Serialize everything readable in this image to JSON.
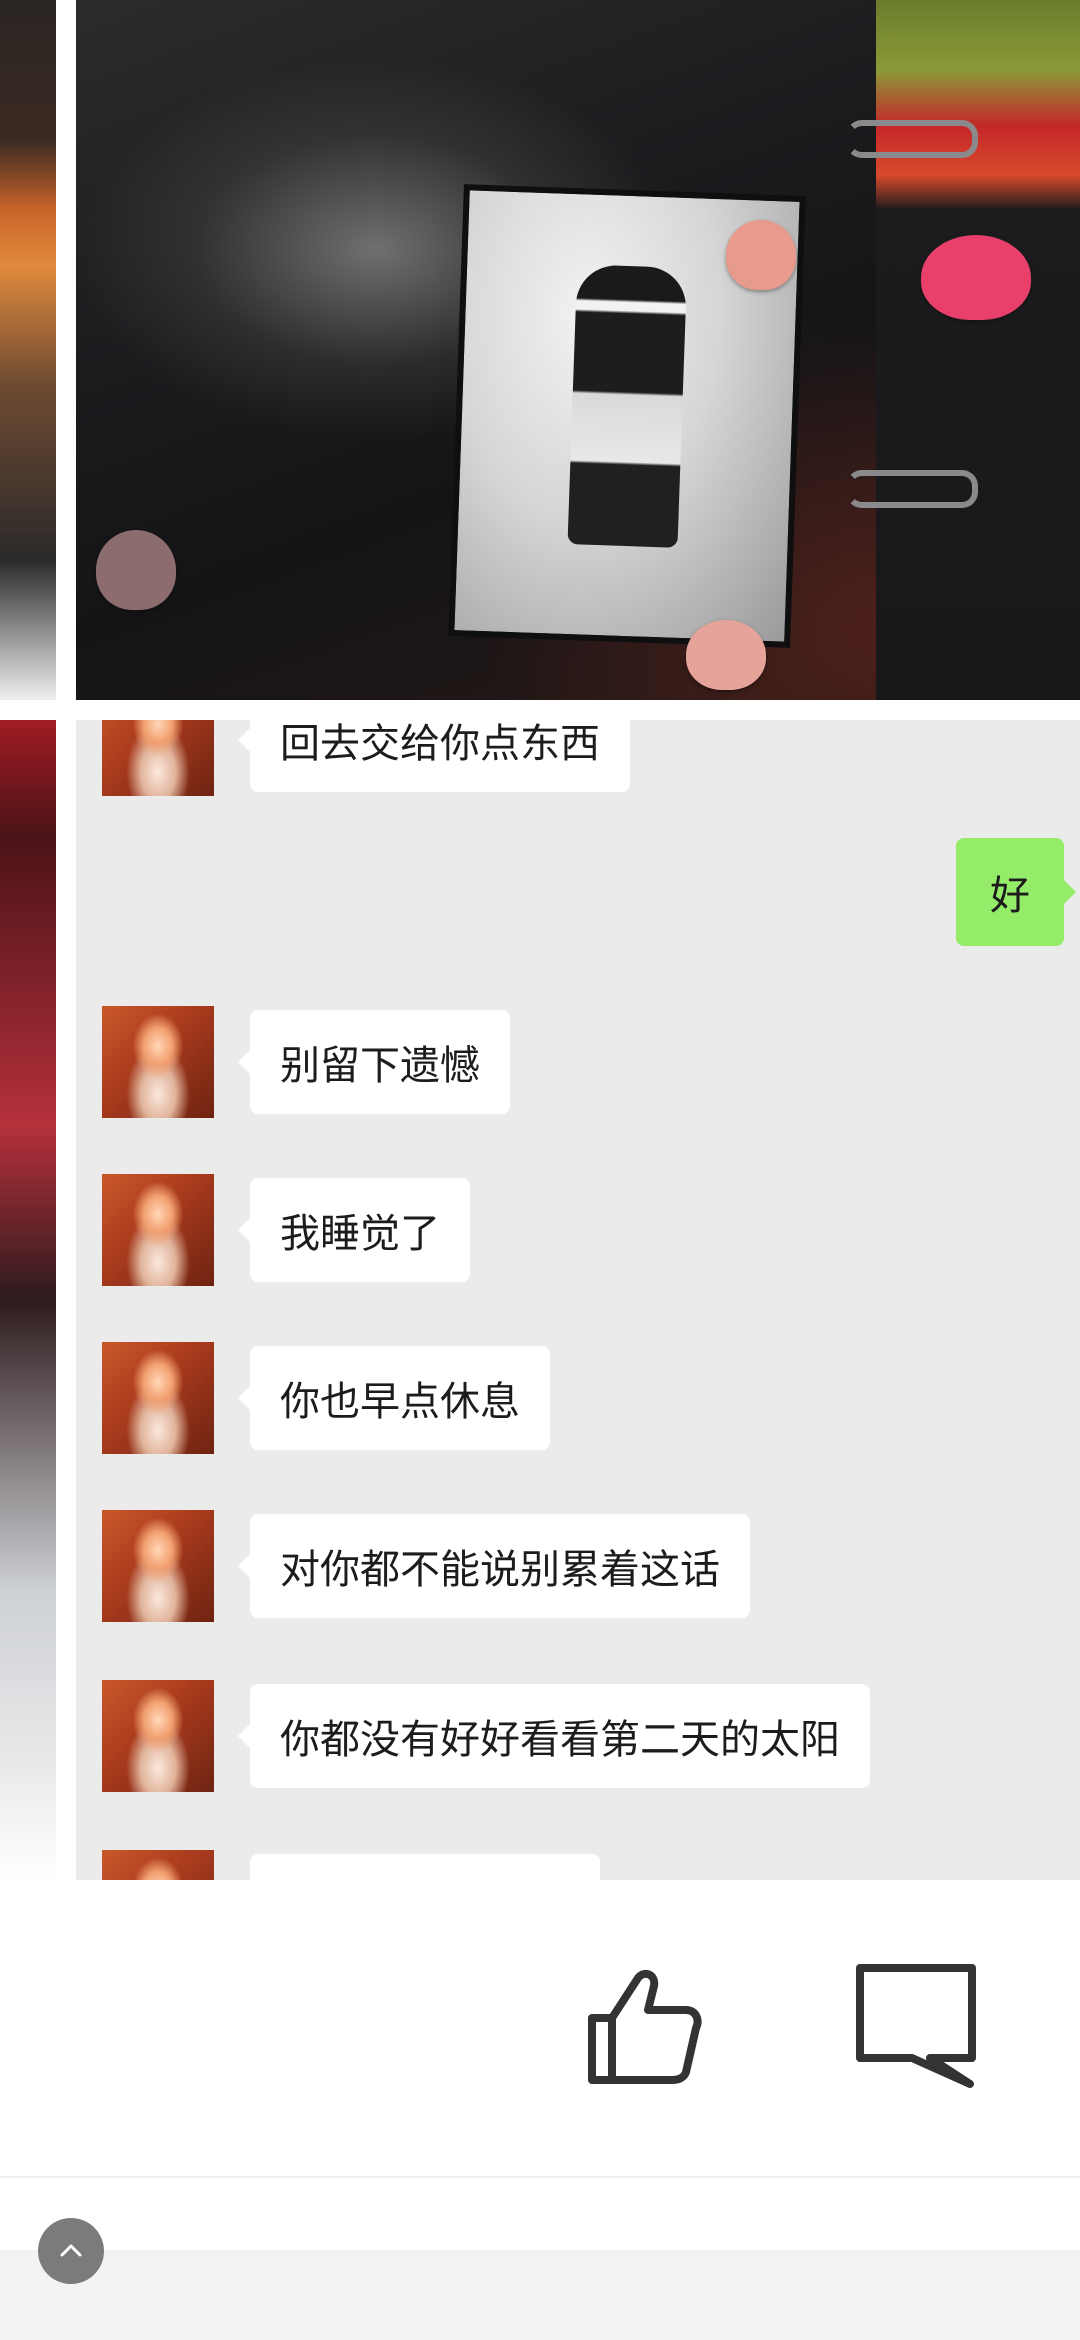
{
  "chat": {
    "messages": [
      {
        "sender": "other",
        "text": "回去交给你点东西"
      },
      {
        "sender": "self",
        "text": "好"
      },
      {
        "sender": "other",
        "text": "别留下遗憾"
      },
      {
        "sender": "other",
        "text": "我睡觉了"
      },
      {
        "sender": "other",
        "text": "你也早点休息"
      },
      {
        "sender": "other",
        "text": "对你都不能说别累着这话"
      },
      {
        "sender": "other",
        "text": "你都没有好好看看第二天的太阳"
      },
      {
        "sender": "other",
        "text": ""
      }
    ],
    "colors": {
      "background": "#ebebeb",
      "other_bubble": "#ffffff",
      "self_bubble": "#95ec69"
    }
  },
  "actions": {
    "like_icon": "thumbs-up-icon",
    "comment_icon": "comment-icon",
    "icon_color": "#333333"
  },
  "footer": {
    "scroll_top_icon": "chevron-up-icon",
    "button_color": "#7b7b7b"
  }
}
